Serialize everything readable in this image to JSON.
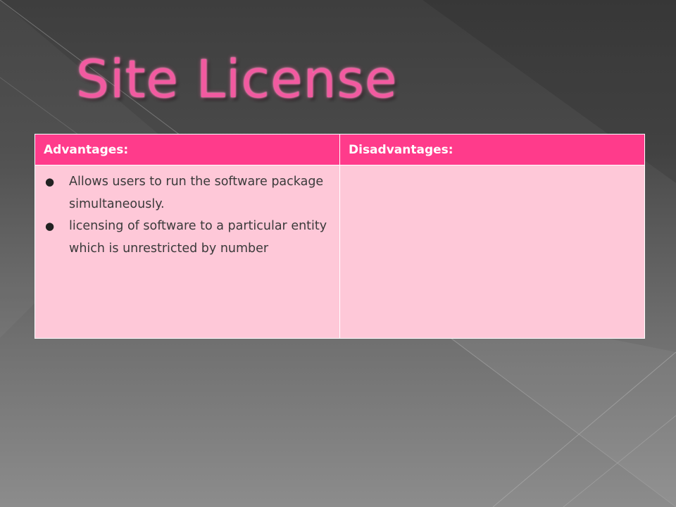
{
  "slide": {
    "title": "Site License"
  },
  "table": {
    "headers": [
      "Advantages:",
      "Disadvantages:"
    ],
    "advantages": [
      "Allows users to run the software package simultaneously.",
      "licensing of software to a particular entity which is unrestricted by number"
    ],
    "disadvantages": []
  },
  "colors": {
    "title": "#f25aa0",
    "header_background": "#ff3b8b",
    "cell_background": "#fec8d8",
    "background_dark": "#3e3e3e",
    "background_light": "#8c8c8c"
  }
}
